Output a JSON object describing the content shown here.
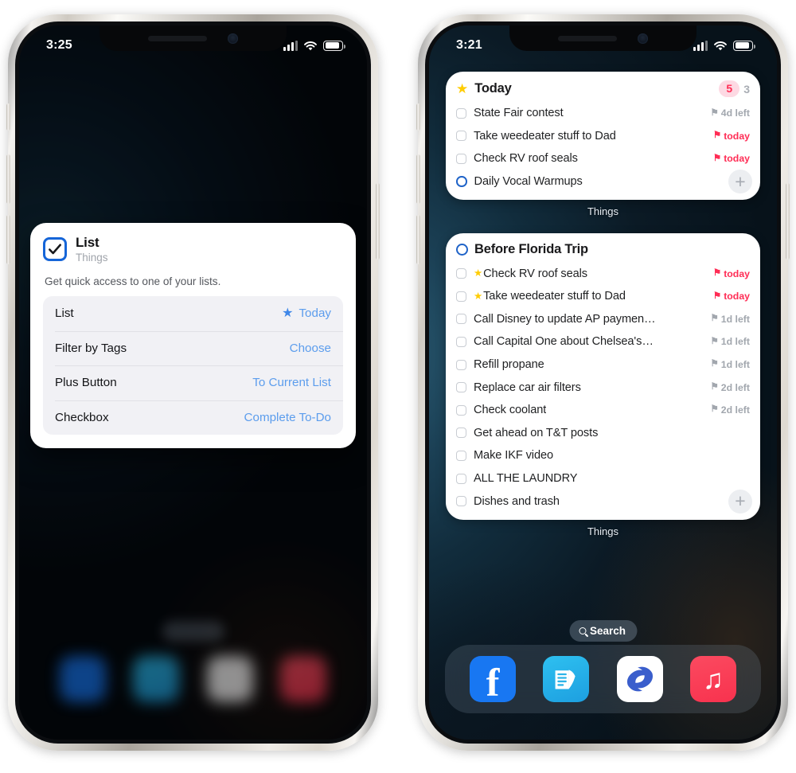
{
  "left_phone": {
    "status": {
      "time": "3:25",
      "signal_icon": "cellular-bars-icon",
      "wifi_icon": "wifi-icon",
      "battery_icon": "battery-icon"
    },
    "config_card": {
      "icon_name": "checkbox-checked-icon",
      "title": "List",
      "subtitle": "Things",
      "description": "Get quick access to one of your lists.",
      "rows": [
        {
          "key": "List",
          "value": "Today",
          "value_icon": "star-icon"
        },
        {
          "key": "Filter by Tags",
          "value": "Choose",
          "value_icon": ""
        },
        {
          "key": "Plus Button",
          "value": "To Current List",
          "value_icon": ""
        },
        {
          "key": "Checkbox",
          "value": "Complete To-Do",
          "value_icon": ""
        }
      ]
    }
  },
  "right_phone": {
    "status": {
      "time": "3:21",
      "signal_icon": "cellular-bars-icon",
      "wifi_icon": "wifi-icon",
      "battery_icon": "battery-icon"
    },
    "widgets": [
      {
        "header_icon": "star-icon",
        "header_icon_type": "star",
        "title": "Today",
        "badge_count": "5",
        "secondary_count": "3",
        "app_label": "Things",
        "plus_button_label": "+",
        "todos": [
          {
            "checkbox": "square",
            "starred": false,
            "text": "State Fair contest",
            "meta": "4d left",
            "meta_style": "grey",
            "flag_icon": "flag-icon"
          },
          {
            "checkbox": "square",
            "starred": false,
            "text": "Take weedeater stuff to Dad",
            "meta": "today",
            "meta_style": "red",
            "flag_icon": "flag-icon"
          },
          {
            "checkbox": "square",
            "starred": false,
            "text": "Check RV roof seals",
            "meta": "today",
            "meta_style": "red",
            "flag_icon": "flag-icon"
          },
          {
            "checkbox": "circle",
            "starred": false,
            "text": "Daily Vocal Warmups",
            "meta": "",
            "meta_style": "grey",
            "flag_icon": ""
          }
        ]
      },
      {
        "header_icon": "open-circle-icon",
        "header_icon_type": "circle",
        "title": "Before Florida Trip",
        "badge_count": "",
        "secondary_count": "",
        "app_label": "Things",
        "plus_button_label": "+",
        "todos": [
          {
            "checkbox": "square",
            "starred": true,
            "text": "Check RV roof seals",
            "meta": "today",
            "meta_style": "red",
            "flag_icon": "flag-icon"
          },
          {
            "checkbox": "square",
            "starred": true,
            "text": "Take weedeater stuff to Dad",
            "meta": "today",
            "meta_style": "red",
            "flag_icon": "flag-icon"
          },
          {
            "checkbox": "square",
            "starred": false,
            "text": "Call Disney to update AP paymen…",
            "meta": "1d left",
            "meta_style": "grey",
            "flag_icon": "flag-icon"
          },
          {
            "checkbox": "square",
            "starred": false,
            "text": "Call Capital One about Chelsea's…",
            "meta": "1d left",
            "meta_style": "grey",
            "flag_icon": "flag-icon"
          },
          {
            "checkbox": "square",
            "starred": false,
            "text": "Refill propane",
            "meta": "1d left",
            "meta_style": "grey",
            "flag_icon": "flag-icon"
          },
          {
            "checkbox": "square",
            "starred": false,
            "text": "Replace car air filters",
            "meta": "2d left",
            "meta_style": "grey",
            "flag_icon": "flag-icon"
          },
          {
            "checkbox": "square",
            "starred": false,
            "text": "Check coolant",
            "meta": "2d left",
            "meta_style": "grey",
            "flag_icon": "flag-icon"
          },
          {
            "checkbox": "square",
            "starred": false,
            "text": "Get ahead on T&T posts",
            "meta": "",
            "meta_style": "grey",
            "flag_icon": ""
          },
          {
            "checkbox": "square",
            "starred": false,
            "text": "Make IKF video",
            "meta": "",
            "meta_style": "grey",
            "flag_icon": ""
          },
          {
            "checkbox": "square",
            "starred": false,
            "text": "ALL THE LAUNDRY",
            "meta": "",
            "meta_style": "grey",
            "flag_icon": ""
          },
          {
            "checkbox": "square",
            "starred": false,
            "text": "Dishes and trash",
            "meta": "",
            "meta_style": "grey",
            "flag_icon": ""
          }
        ]
      }
    ],
    "search": {
      "label": "Search",
      "icon": "magnifier-icon"
    },
    "dock": [
      {
        "name": "facebook",
        "icon": "facebook-icon",
        "color": "#1877f2"
      },
      {
        "name": "news-reader",
        "icon": "news-reader-icon",
        "color": "#25b3e8"
      },
      {
        "name": "simplenote",
        "icon": "simplenote-icon",
        "color": "#ffffff"
      },
      {
        "name": "apple-music",
        "icon": "music-note-icon",
        "color": "#fa3c54"
      }
    ]
  },
  "colors": {
    "accent_blue": "#5c9ded",
    "badge_red": "#ff2d55",
    "star_yellow": "#ffcc00",
    "icon_border_blue": "#1565d8",
    "meta_grey": "#a2a7ae"
  }
}
